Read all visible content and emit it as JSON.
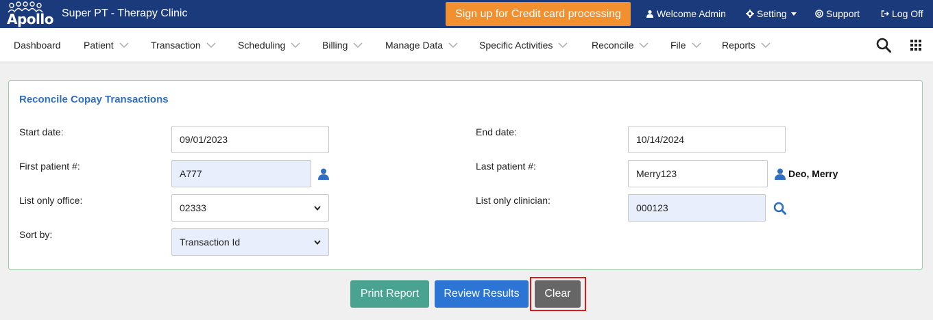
{
  "header": {
    "logo_text": "Apollo",
    "clinic_name": "Super PT - Therapy Clinic",
    "cc_button": "Sign up for Credit card processing",
    "welcome": "Welcome Admin",
    "setting": "Setting",
    "support": "Support",
    "logoff": "Log Off"
  },
  "nav": {
    "items": [
      {
        "label": "Dashboard",
        "dropdown": false
      },
      {
        "label": "Patient",
        "dropdown": true
      },
      {
        "label": "Transaction",
        "dropdown": true
      },
      {
        "label": "Scheduling",
        "dropdown": true
      },
      {
        "label": "Billing",
        "dropdown": true
      },
      {
        "label": "Manage Data",
        "dropdown": true
      },
      {
        "label": "Specific Activities",
        "dropdown": true
      },
      {
        "label": "Reconcile",
        "dropdown": true
      },
      {
        "label": "File",
        "dropdown": true
      },
      {
        "label": "Reports",
        "dropdown": true
      }
    ]
  },
  "form": {
    "title": "Reconcile Copay Transactions",
    "start_date_label": "Start date:",
    "start_date_value": "09/01/2023",
    "end_date_label": "End date:",
    "end_date_value": "10/14/2024",
    "first_patient_label": "First patient #:",
    "first_patient_value": "A777",
    "last_patient_label": "Last patient #:",
    "last_patient_value": "Merry123",
    "last_patient_name": "Deo, Merry",
    "office_label": "List only office:",
    "office_value": "02333",
    "clinician_label": "List only clinician:",
    "clinician_value": "000123",
    "sort_label": "Sort by:",
    "sort_value": "Transaction Id"
  },
  "buttons": {
    "print": "Print Report",
    "review": "Review Results",
    "clear": "Clear"
  },
  "colors": {
    "header_bg": "#1a3a7c",
    "cc_button": "#f28f2e",
    "title_blue": "#2e6fc4",
    "print_btn": "#4aa391",
    "review_btn": "#2d75d4",
    "clear_btn": "#666666",
    "highlight": "#e0191d"
  }
}
